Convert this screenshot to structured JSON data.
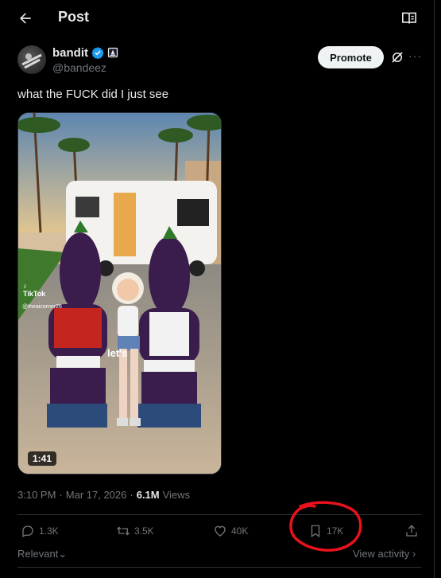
{
  "header": {
    "title": "Post"
  },
  "author": {
    "display_name": "bandit",
    "handle": "@bandeez"
  },
  "buttons": {
    "promote": "Promote",
    "more": "···"
  },
  "tweet": {
    "text": "what the FUCK did I just see"
  },
  "media": {
    "duration": "1:41",
    "watermark": "TikTok",
    "watermark_handle": "@theaicorner26",
    "caption": "let's"
  },
  "meta": {
    "time": "3:10 PM",
    "separator": "·",
    "date": "Mar 17, 2026",
    "views_count": "6.1M",
    "views_label": "Views"
  },
  "actions": {
    "replies": "1.3K",
    "reposts": "3.5K",
    "likes": "40K",
    "bookmarks": "17K"
  },
  "footer": {
    "relevant": "Relevant",
    "view_activity": "View activity"
  },
  "colors": {
    "accent_blue": "#1d9bf0",
    "annotation_red": "#e8121c",
    "text_secondary": "#71767b"
  }
}
